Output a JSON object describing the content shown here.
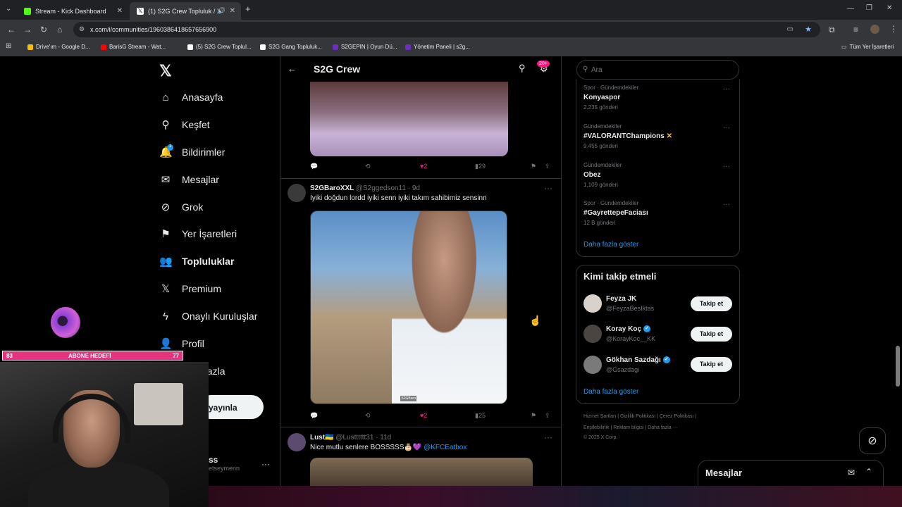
{
  "browser": {
    "tabs": [
      {
        "title": "Stream - Kick Dashboard",
        "favicon_color": "#53fc18"
      },
      {
        "title": "(1) S2G Crew Topluluk / X",
        "favicon_color": "#000000"
      }
    ],
    "url": "x.com/i/communities/1960386418657656900",
    "bookmarks": [
      {
        "label": "Drive'ım - Google D...",
        "color": "#fbbc04"
      },
      {
        "label": "BarisG Stream - Wat...",
        "color": "#ff0000"
      },
      {
        "label": "(5) S2G Crew Toplul...",
        "color": "#000000"
      },
      {
        "label": "S2G Gang Topluluk...",
        "color": "#000000"
      },
      {
        "label": "S2GEPIN | Oyun Dü...",
        "color": "#6b2fbf"
      },
      {
        "label": "Yönetim Paneli | s2g...",
        "color": "#6b2fbf"
      }
    ],
    "all_bookmarks": "Tüm Yer İşaretleri"
  },
  "nav": {
    "items": [
      {
        "label": "Anasayfa",
        "icon": "home-icon",
        "glyph": "⌂"
      },
      {
        "label": "Keşfet",
        "icon": "search-icon",
        "glyph": "⚲"
      },
      {
        "label": "Bildirimler",
        "icon": "bell-icon",
        "glyph": "🔔"
      },
      {
        "label": "Mesajlar",
        "icon": "mail-icon",
        "glyph": "✉"
      },
      {
        "label": "Grok",
        "icon": "grok-icon",
        "glyph": "⊘"
      },
      {
        "label": "Yer İşaretleri",
        "icon": "bookmark-icon",
        "glyph": "⚑"
      },
      {
        "label": "Topluluklar",
        "icon": "communities-icon",
        "glyph": "👥"
      },
      {
        "label": "Premium",
        "icon": "x-premium-icon",
        "glyph": "𝕏"
      },
      {
        "label": "Onaylı Kuruluşlar",
        "icon": "lightning-icon",
        "glyph": "ϟ"
      },
      {
        "label": "Profil",
        "icon": "person-icon",
        "glyph": "👤"
      },
      {
        "label": "fazla",
        "icon": "more-icon",
        "glyph": ""
      }
    ],
    "notif_count": "1",
    "post_button": "yayınla",
    "account_name": "ss",
    "account_handle": "etseymenn"
  },
  "main": {
    "title": "S2G Crew",
    "notif_badge": "20+",
    "tweets": [
      {
        "likes": "2",
        "views": "29"
      },
      {
        "name": "S2GBaroXXL",
        "handle": "@S2ggedson11 · 9d",
        "text": "İyiki doğdun lordd iyiki senn iyiki takım sahibimiz sensinn",
        "image_watermark": "S2GBaro",
        "likes": "2",
        "views": "25"
      },
      {
        "name": "Lust🇺🇦",
        "handle": "@Lustttttt31 · 11d",
        "text": "Nice mutlu senlere BOSSSSS🎂💜 ",
        "mention": "@KFCEatbox"
      }
    ]
  },
  "right": {
    "search_placeholder": "Ara",
    "trends": [
      {
        "category": "Spor · Gündemdekiler",
        "name": "Konyaspor",
        "count": "2.235 gönderi"
      },
      {
        "category": "Gündemdekiler",
        "name": "#VALORANTChampions",
        "count": "9.455 gönderi"
      },
      {
        "category": "Gündemdekiler",
        "name": "Obez",
        "count": "1.109 gönderi"
      },
      {
        "category": "Spor · Gündemdekiler",
        "name": "#GayrettepeFaciası",
        "count": "12 B gönderi"
      }
    ],
    "show_more": "Daha fazla göster",
    "who_to_follow_title": "Kimi takip etmeli",
    "follow_suggestions": [
      {
        "name": "Feyza JK",
        "handle": "@FeyzaBesIktas",
        "verified": false
      },
      {
        "name": "Koray Koç",
        "handle": "@KorayKoc__KK",
        "verified": true
      },
      {
        "name": "Gökhan Sazdağı",
        "handle": "@Gsazdagi",
        "verified": true
      }
    ],
    "follow_label": "Takip et",
    "follow_show_more": "Daha fazla göster",
    "footer_line1": "Hizmet Şartları  |  Gizlilik Politikası  |  Çerez Politikası  |",
    "footer_line2": "Erişilebilirlik  |  Reklam bilgisi  |  Daha fazla ···",
    "footer_line3": "© 2025 X Corp.",
    "messages_dock": "Mesajlar"
  },
  "overlay": {
    "sub_goal_label": "ABONE HEDEFİ",
    "sub_current": "83",
    "sub_target": "77"
  }
}
